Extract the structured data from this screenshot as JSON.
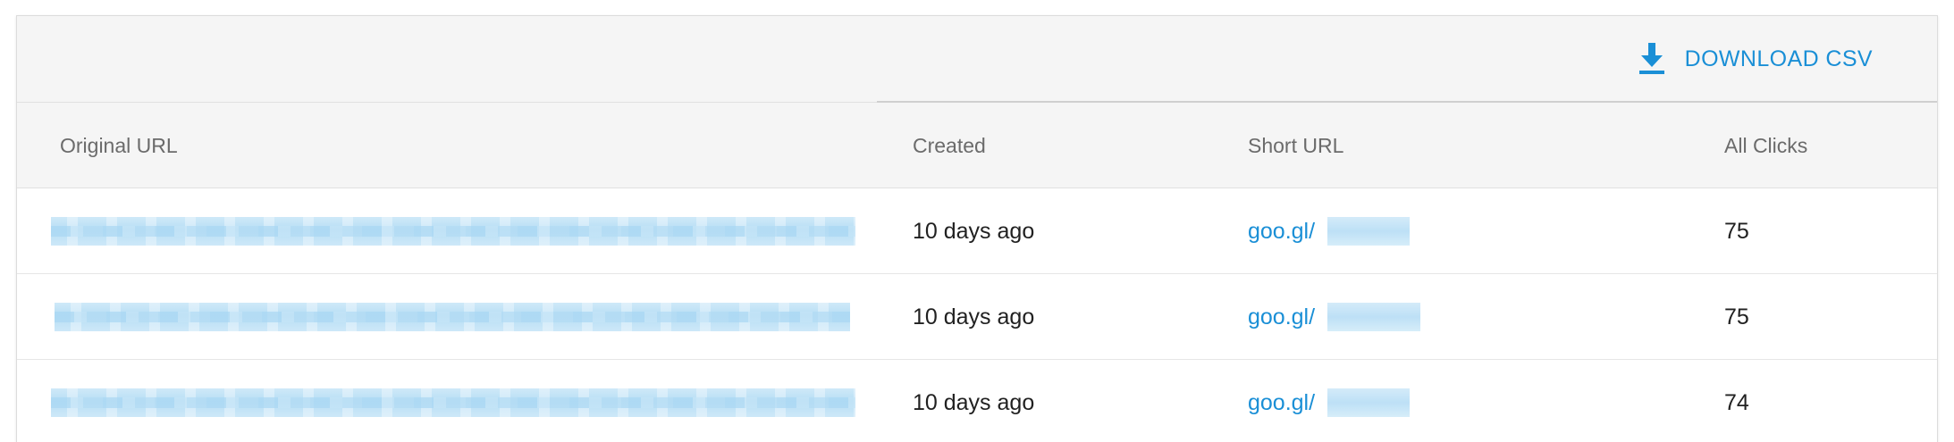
{
  "toolbar": {
    "download_label": "DOWNLOAD CSV",
    "download_icon": "download-icon"
  },
  "table": {
    "columns": [
      "Original URL",
      "Created",
      "Short URL",
      "All Clicks"
    ],
    "rows": [
      {
        "original_url": "",
        "created": "10 days ago",
        "short_url": "goo.gl/",
        "clicks": "75"
      },
      {
        "original_url": "",
        "created": "10 days ago",
        "short_url": "goo.gl/",
        "clicks": "75"
      },
      {
        "original_url": "",
        "created": "10 days ago",
        "short_url": "goo.gl/",
        "clicks": "74"
      }
    ]
  },
  "colors": {
    "accent": "#1a8fd6",
    "header_bg": "#f5f5f5",
    "redacted": "#b7def5"
  }
}
